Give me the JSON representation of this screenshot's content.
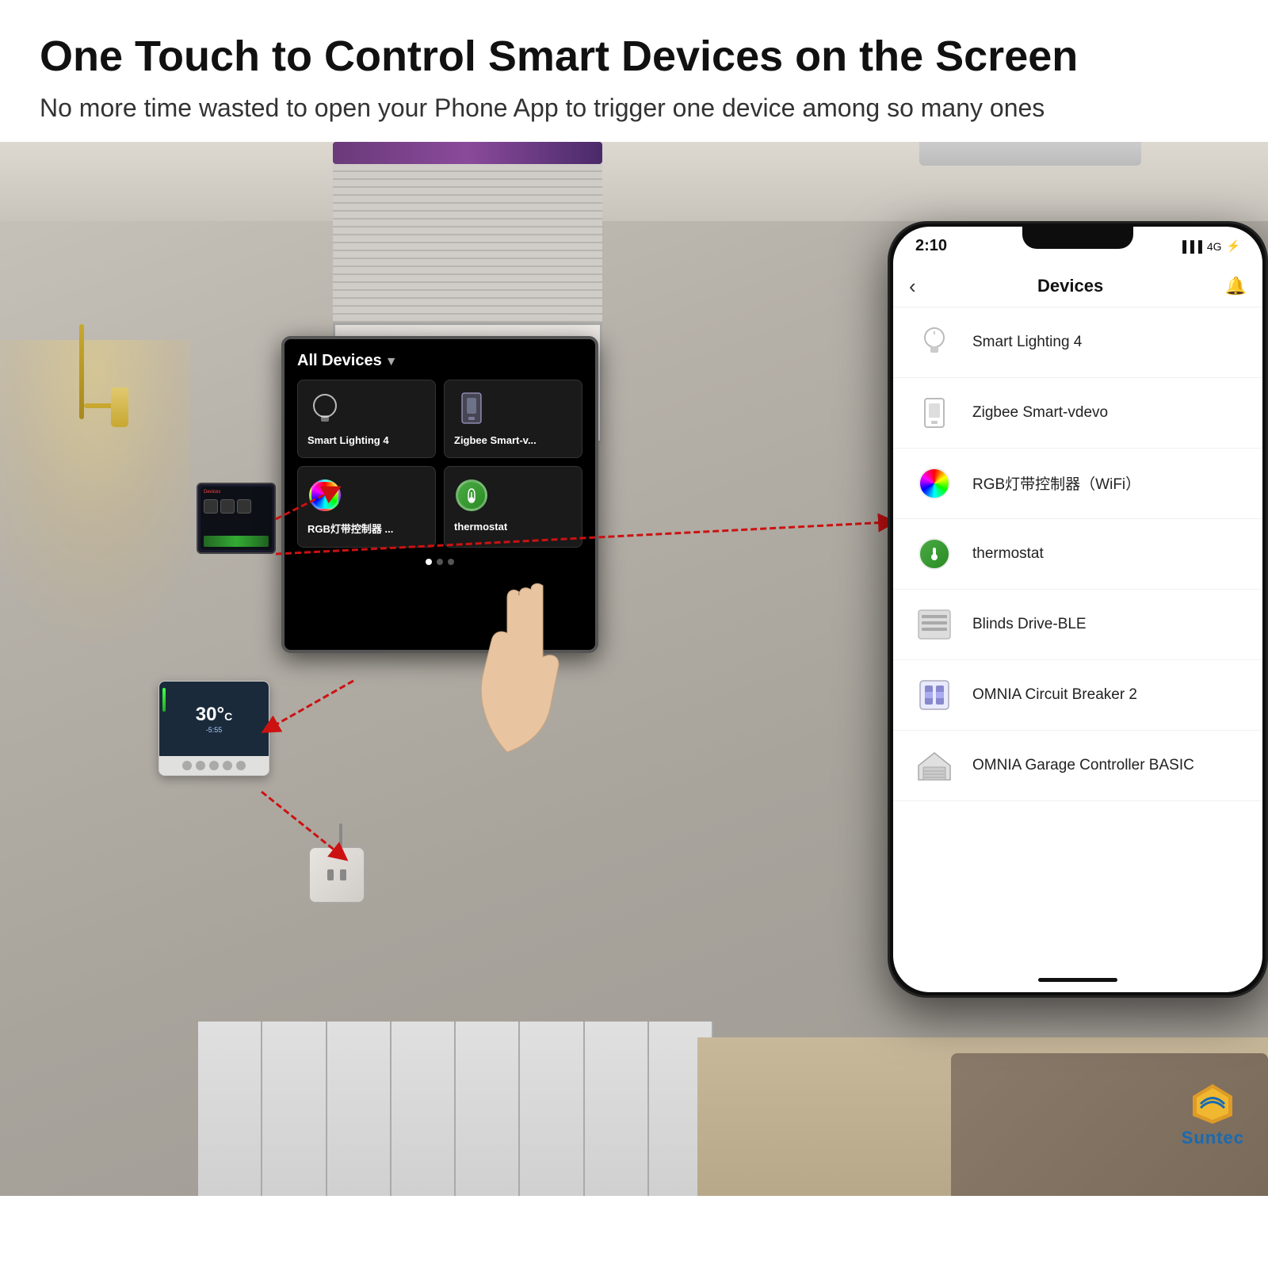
{
  "header": {
    "title": "One Touch to Control Smart Devices on the Screen",
    "subtitle": "No more time wasted to open your Phone App to trigger one device among so many ones"
  },
  "panel": {
    "title": "All Devices",
    "items": [
      {
        "label": "Smart Lighting 4",
        "icon": "bulb"
      },
      {
        "label": "Zigbee Smart-v...",
        "icon": "zigbee"
      },
      {
        "label": "RGB灯带控制器 ...",
        "icon": "rgb"
      },
      {
        "label": "thermostat",
        "icon": "thermostat"
      }
    ]
  },
  "phone": {
    "status": {
      "time": "2:10",
      "signal": "4G"
    },
    "header": {
      "title": "Devices",
      "back_icon": "‹",
      "settings_icon": "🔔"
    },
    "devices": [
      {
        "name": "Smart Lighting 4",
        "icon": "bulb"
      },
      {
        "name": "Zigbee Smart-vdevo",
        "icon": "zigbee"
      },
      {
        "name": "RGB灯带控制器（WiFi）",
        "icon": "rgb"
      },
      {
        "name": "thermostat",
        "icon": "thermostat"
      },
      {
        "name": "Blinds Drive-BLE",
        "icon": "blinds"
      },
      {
        "name": "OMNIA Circuit Breaker 2",
        "icon": "breaker"
      },
      {
        "name": "OMNIA Garage Controller BASIC",
        "icon": "garage"
      }
    ]
  },
  "thermostat": {
    "temp": "30°C",
    "time": "-5:55"
  },
  "suntec": {
    "name": "Suntec"
  }
}
